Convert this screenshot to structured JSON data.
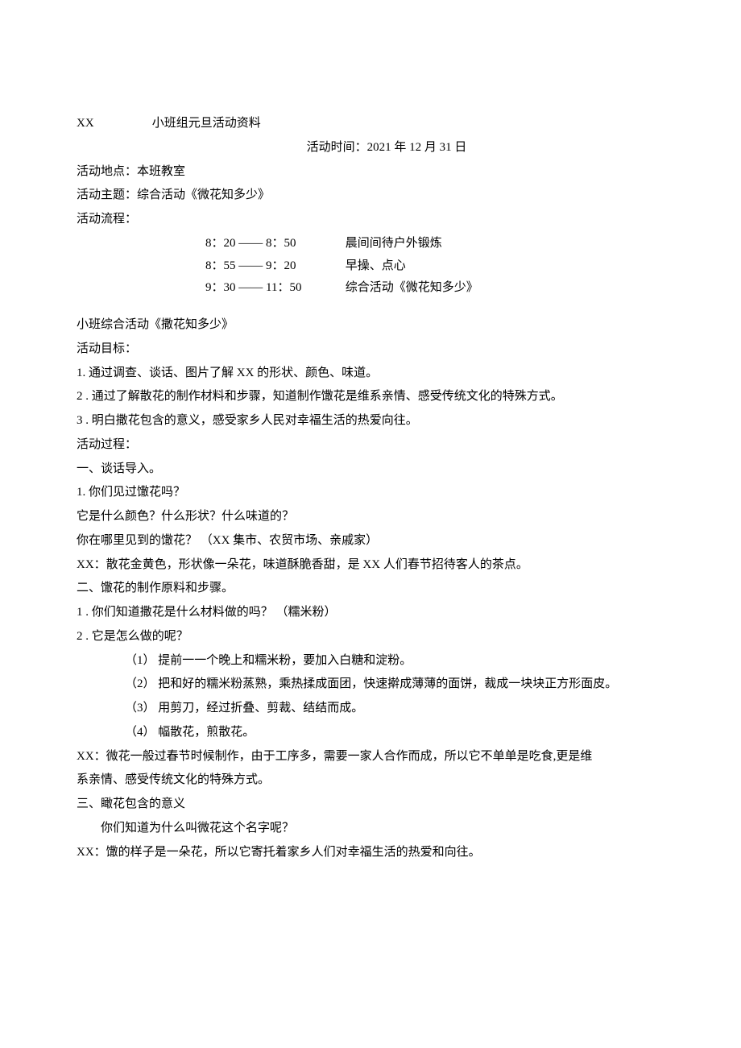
{
  "title": {
    "prefix": "XX",
    "text": "小班组元旦活动资料"
  },
  "activity_time_label": "活动时间：",
  "activity_time_value": "2021 年 12 月 31 日",
  "location_label": "活动地点：",
  "location_value": "本班教室",
  "theme_label": "活动主题：",
  "theme_value": "综合活动《微花知多少》",
  "flow_label": "活动流程：",
  "schedule": [
    {
      "time": "8：20 ―― 8：50",
      "desc": "晨间间待户外锻炼"
    },
    {
      "time": "8：55 ―― 9：20",
      "desc": "早操、点心"
    },
    {
      "time": "9：30 ―― 11：50",
      "desc": "综合活动《微花知多少》"
    }
  ],
  "sub_activity_title": "小班综合活动《撒花知多少》",
  "goals_header": "活动目标：",
  "goals": [
    {
      "num": "1.",
      "text": "通过调查、谈话、图片了解 XX 的形状、颜色、味道。"
    },
    {
      "num": "2  .",
      "text": "通过了解散花的制作材料和步骤，知道制作馓花是维系亲情、感受传统文化的特殊方式。"
    },
    {
      "num": "3  .",
      "text": "明白撒花包含的意义，感受家乡人民对幸福生活的热爱向往。"
    }
  ],
  "process_header": "活动过程：",
  "part1": {
    "header": "一、谈话导入。",
    "q1": "1. 你们见过馓花吗？",
    "q1_sub1": "它是什么颜色？什么形状？什么味道的？",
    "q1_sub2": "你在哪里见到的馓花？ （XX 集市、农贸市场、亲戚家）",
    "xx_note": "XX：散花金黄色，形状像一朵花，味道酥脆香甜，是 XX 人们春节招待客人的茶点。"
  },
  "part2": {
    "header": "二、馓花的制作原料和步骤。",
    "q1": {
      "num": "1  .",
      "text": "你们知道撒花是什么材料做的吗？ （糯米粉）"
    },
    "q2": {
      "num": "2  .",
      "text": "它是怎么做的呢？"
    },
    "steps": [
      "（1） 提前一一个晚上和糯米粉，要加入白糖和淀粉。",
      "（2） 把和好的糯米粉蒸熟，乘热揉成面团，快速擀成薄薄的面饼，裁成一块块正方形面皮。",
      "（3） 用剪刀，经过折叠、剪裁、结结而成。",
      "（4） 幅散花，煎散花。"
    ],
    "xx_note_l1": "XX：微花一般过春节时候制作，由于工序多，需要一家人合作而成，所以它不单单是吃食,更是维",
    "xx_note_l2": "系亲情、感受传统文化的特殊方式。"
  },
  "part3": {
    "header": "三、瞰花包含的意义",
    "q": "你们知道为什么叫微花这个名字呢？",
    "xx_note": "XX：馓的样子是一朵花，所以它寄托着家乡人们对幸福生活的热爱和向往。"
  }
}
